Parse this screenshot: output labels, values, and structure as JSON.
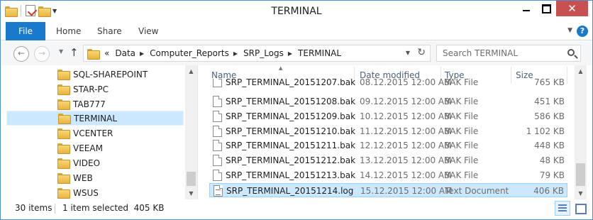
{
  "window": {
    "title": "TERMINAL"
  },
  "ribbon": {
    "tabs": [
      "File",
      "Home",
      "Share",
      "View"
    ]
  },
  "address": {
    "overflow": "«",
    "crumbs": [
      "Data",
      "Computer_Reports",
      "SRP_Logs",
      "TERMINAL"
    ]
  },
  "search": {
    "placeholder": "Search TERMINAL"
  },
  "nav_tree": {
    "items": [
      "SQL-SHAREPOINT",
      "STAR-PC",
      "TAB777",
      "TERMINAL",
      "VCENTER",
      "VEEAM",
      "VIDEO",
      "WEB",
      "WSUS"
    ],
    "selected": "TERMINAL"
  },
  "file_list": {
    "columns": {
      "name": "Name",
      "date": "Date modified",
      "type": "Type",
      "size": "Size"
    },
    "rows": [
      {
        "name": "SRP_TERMINAL_20151207.bak",
        "date": "08.12.2015 12:00 AM",
        "type": "BAK File",
        "size": "765 KB",
        "icon": "file-icon"
      },
      {
        "name": "SRP_TERMINAL_20151208.bak",
        "date": "09.12.2015 12:00 AM",
        "type": "BAK File",
        "size": "451 KB",
        "icon": "file-icon"
      },
      {
        "name": "SRP_TERMINAL_20151209.bak",
        "date": "10.12.2015 12:00 AM",
        "type": "BAK File",
        "size": "586 KB",
        "icon": "file-icon"
      },
      {
        "name": "SRP_TERMINAL_20151210.bak",
        "date": "11.12.2015 12:00 AM",
        "type": "BAK File",
        "size": "1 102 KB",
        "icon": "file-icon"
      },
      {
        "name": "SRP_TERMINAL_20151211.bak",
        "date": "12.12.2015 12:00 AM",
        "type": "BAK File",
        "size": "448 KB",
        "icon": "file-icon"
      },
      {
        "name": "SRP_TERMINAL_20151212.bak",
        "date": "13.12.2015 12:00 AM",
        "type": "BAK File",
        "size": "48 KB",
        "icon": "file-icon"
      },
      {
        "name": "SRP_TERMINAL_20151213.bak",
        "date": "14.12.2015 12:00 AM",
        "type": "BAK File",
        "size": "79 KB",
        "icon": "file-icon"
      },
      {
        "name": "SRP_TERMINAL_20151214.log",
        "date": "15.12.2015 12:00 AM",
        "type": "Text Document",
        "size": "406 KB",
        "icon": "text-file-icon",
        "selected": true
      }
    ]
  },
  "status": {
    "items_count": "30 items",
    "selection": "1 item selected  405 KB"
  },
  "colors": {
    "accent": "#1979ca",
    "selection": "#cce8ff",
    "close_button": "#c75050"
  }
}
